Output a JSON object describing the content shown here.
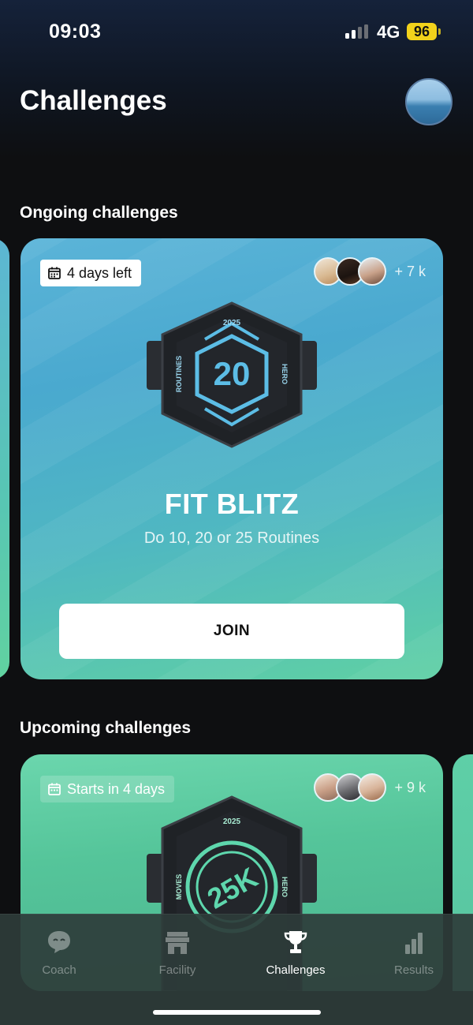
{
  "status_bar": {
    "time": "09:03",
    "network": "4G",
    "battery": "96"
  },
  "header": {
    "title": "Challenges"
  },
  "sections": {
    "ongoing": "Ongoing challenges",
    "upcoming": "Upcoming challenges"
  },
  "ongoing_card": {
    "date_label": "4 days left",
    "participants_count": "+ 7 k",
    "badge": {
      "year": "2025",
      "number": "20",
      "left_text": "ROUTINES",
      "right_text": "HERO"
    },
    "title": "FIT BLITZ",
    "subtitle": "Do 10, 20 or 25 Routines",
    "button_label": "JOIN"
  },
  "upcoming_card": {
    "date_label": "Starts in 4 days",
    "participants_count": "+ 9 k",
    "badge": {
      "year": "2025",
      "number": "25K",
      "left_text": "MOVES",
      "right_text": "HERO"
    }
  },
  "tabs": [
    {
      "label": "Coach",
      "icon": "coach-chat-icon",
      "active": false
    },
    {
      "label": "Facility",
      "icon": "store-icon",
      "active": false
    },
    {
      "label": "Challenges",
      "icon": "trophy-icon",
      "active": true
    },
    {
      "label": "Results",
      "icon": "bar-chart-icon",
      "active": false
    }
  ],
  "colors": {
    "accent_blue": "#5bb4d8",
    "accent_green": "#5fd0a4",
    "battery": "#f2d21b"
  }
}
